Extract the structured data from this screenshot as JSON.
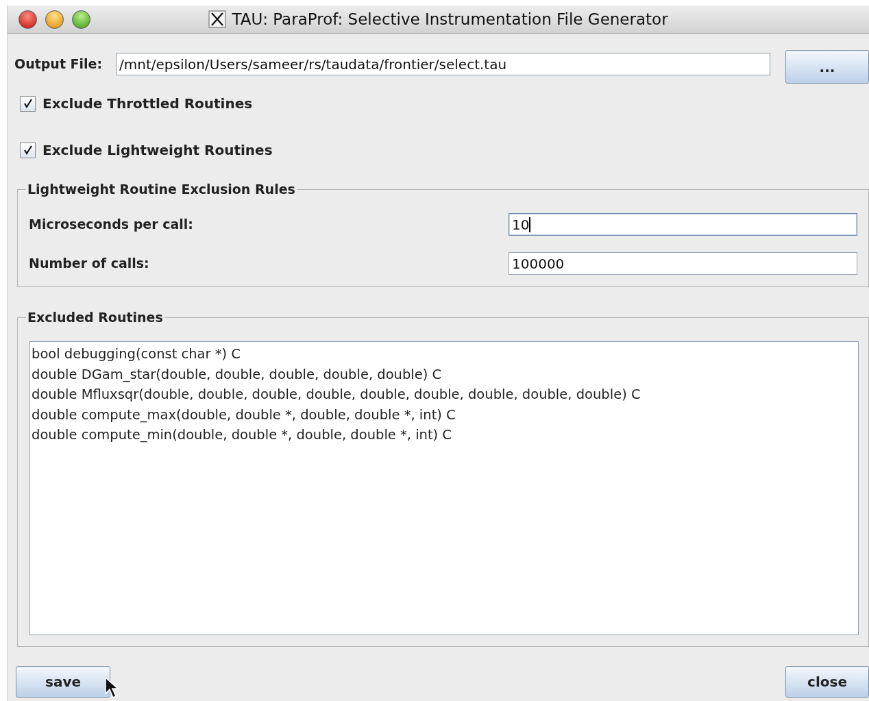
{
  "window": {
    "title": "TAU: ParaProf: Selective Instrumentation File Generator"
  },
  "output_file": {
    "label": "Output File:",
    "value": "/mnt/epsilon/Users/sameer/rs/taudata/frontier/select.tau",
    "browse_button": "..."
  },
  "options": [
    {
      "label": "Exclude Throttled Routines",
      "checked": true
    },
    {
      "label": "Exclude Lightweight Routines",
      "checked": true
    }
  ],
  "exclusion_rules": {
    "title": "Lightweight Routine Exclusion Rules",
    "fields": [
      {
        "label": "Microseconds per call:",
        "value": "10",
        "focused": true
      },
      {
        "label": "Number of calls:",
        "value": "100000",
        "focused": false
      }
    ]
  },
  "excluded_routines": {
    "title": "Excluded Routines",
    "items": [
      "bool debugging(const char *) C",
      "double DGam_star(double, double, double, double, double) C",
      "double Mfluxsqr(double, double, double, double, double, double, double, double, double) C",
      "double compute_max(double, double *, double, double *, int) C",
      "double compute_min(double, double *, double, double *, int) C"
    ]
  },
  "buttons": [
    {
      "label": "save",
      "kind": "left"
    },
    {
      "label": "close",
      "kind": "right"
    }
  ]
}
